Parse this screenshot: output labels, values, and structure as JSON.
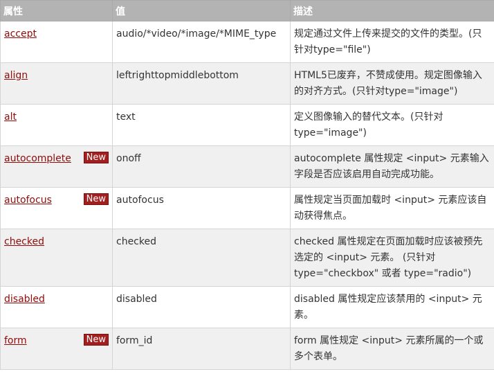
{
  "headers": {
    "attribute": "属性",
    "value": "值",
    "description": "描述"
  },
  "badge_label": "New",
  "rows": [
    {
      "attr": "accept",
      "value": "audio/*video/*image/*MIME_type",
      "desc": "规定通过文件上传来提交的文件的类型。(只针对type=\"file\")"
    },
    {
      "attr": "align",
      "value": "leftrighttopmiddlebottom",
      "desc": "HTML5已废弃，不赞成使用。规定图像输入的对齐方式。(只针对type=\"image\")"
    },
    {
      "attr": "alt",
      "value": "text",
      "desc": "定义图像输入的替代文本。(只针对type=\"image\")"
    },
    {
      "attr": "autocomplete",
      "value": "onoff",
      "desc": "autocomplete 属性规定 <input> 元素输入字段是否应该启用自动完成功能。"
    },
    {
      "attr": "autofocus",
      "value": "autofocus",
      "desc": "属性规定当页面加载时 <input> 元素应该自动获得焦点。"
    },
    {
      "attr": "checked",
      "value": "checked",
      "desc": "checked 属性规定在页面加载时应该被预先选定的 <input> 元素。 (只针对type=\"checkbox\" 或者 type=\"radio\")"
    },
    {
      "attr": "disabled",
      "value": "disabled",
      "desc": "disabled 属性规定应该禁用的 <input> 元素。"
    },
    {
      "attr": "form",
      "value": "form_id",
      "desc": "form 属性规定 <input> 元素所属的一个或多个表单。"
    }
  ]
}
